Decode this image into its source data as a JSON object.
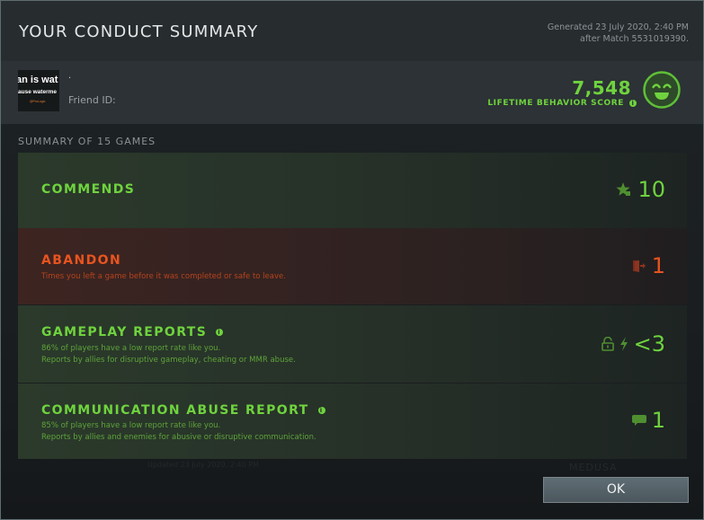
{
  "dialog": {
    "title": "YOUR CONDUCT SUMMARY",
    "generated_line1": "Generated 23 July 2020, 2:40 PM",
    "generated_line2": "after Match 5531019390."
  },
  "profile": {
    "avatar_text_line1": "an is wat",
    "avatar_text_line2": "ause waterme",
    "avatar_text_line3": "@ProLogic",
    "player_name": "·",
    "friend_id_label": "Friend ID:",
    "friend_id_value": "",
    "behavior_score": "7,548",
    "behavior_score_label": "LIFETIME BEHAVIOR SCORE",
    "score_icon": "smiley-face-icon",
    "accent_color": "#6fd33e"
  },
  "summary": {
    "label": "SUMMARY OF 15 GAMES",
    "games_count": 15,
    "cards": [
      {
        "title": "COMMENDS",
        "description_lines": [],
        "icons": [
          "star-thumbs-up-icon"
        ],
        "value": "10",
        "status": "good",
        "color": "#6fd33e"
      },
      {
        "title": "ABANDON",
        "description_lines": [
          "Times you left a game before it was completed or safe to leave."
        ],
        "icons": [
          "door-exit-icon"
        ],
        "value": "1",
        "status": "bad",
        "color": "#e8541f"
      },
      {
        "title": "GAMEPLAY REPORTS",
        "has_info": true,
        "description_lines": [
          "86% of players have a low report rate like you.",
          "Reports by allies for disruptive gameplay, cheating or MMR abuse."
        ],
        "icons": [
          "unlock-icon",
          "lightning-icon"
        ],
        "value": "<3",
        "status": "good",
        "color": "#6fd33e"
      },
      {
        "title": "COMMUNICATION ABUSE REPORT",
        "has_info": true,
        "description_lines": [
          "85% of players have a low report rate like you.",
          "Reports by allies and enemies for abusive or disruptive communication."
        ],
        "icons": [
          "chat-bubble-icon"
        ],
        "value": "1",
        "status": "good",
        "color": "#6fd33e"
      }
    ]
  },
  "background_ghost": {
    "hero_name": "MEDUSA",
    "updated": "Updated 23 July 2020, 2:40 PM"
  },
  "footer": {
    "ok_label": "OK"
  }
}
